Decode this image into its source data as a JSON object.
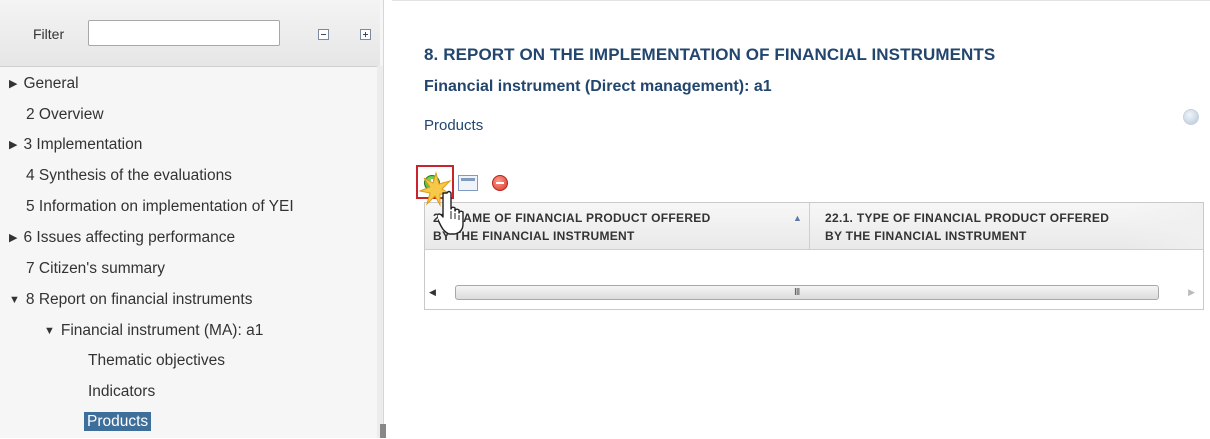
{
  "sidebar": {
    "filter_label": "Filter",
    "filter_value": "",
    "tree": [
      {
        "label": "General",
        "arrow": "▶",
        "level": 0
      },
      {
        "label": "2 Overview",
        "arrow": "",
        "level": 0
      },
      {
        "label": "3 Implementation",
        "arrow": "▶",
        "level": 0
      },
      {
        "label": "4 Synthesis of the evaluations",
        "arrow": "",
        "level": 0
      },
      {
        "label": "5 Information on implementation of YEI",
        "arrow": "",
        "level": 0
      },
      {
        "label": "6 Issues affecting performance",
        "arrow": "▶",
        "level": 0
      },
      {
        "label": "7 Citizen's summary",
        "arrow": "",
        "level": 0
      },
      {
        "label": "8 Report on financial instruments",
        "arrow": "▼",
        "level": 0
      },
      {
        "label": "Financial instrument (MA): a1",
        "arrow": "▼",
        "level": 1
      },
      {
        "label": "Thematic objectives",
        "arrow": "",
        "level": 2
      },
      {
        "label": "Indicators",
        "arrow": "",
        "level": 2
      },
      {
        "label": "Products",
        "arrow": "",
        "level": 2,
        "selected": true
      }
    ]
  },
  "main": {
    "section_title": "8. REPORT ON THE IMPLEMENTATION OF FINANCIAL INSTRUMENTS",
    "sub_title": "Financial instrument (Direct management): a1",
    "products_label": "Products",
    "grid": {
      "columns": [
        "22. NAME OF FINANCIAL PRODUCT OFFERED BY THE FINANCIAL INSTRUMENT",
        "22.1. TYPE OF FINANCIAL PRODUCT OFFERED BY THE FINANCIAL INSTRUMENT"
      ],
      "col1_line1": "22. NAME OF FINANCIAL PRODUCT OFFERED",
      "col1_line2": "BY THE FINANCIAL INSTRUMENT",
      "col2_line1": "22.1. TYPE OF FINANCIAL PRODUCT OFFERED",
      "col2_line2": "BY THE FINANCIAL INSTRUMENT",
      "rows": [],
      "scroll_grip": "III"
    }
  },
  "colors": {
    "title": "#22466e",
    "selected_bg": "#3e6e9a",
    "highlight_border": "#c9242b"
  }
}
